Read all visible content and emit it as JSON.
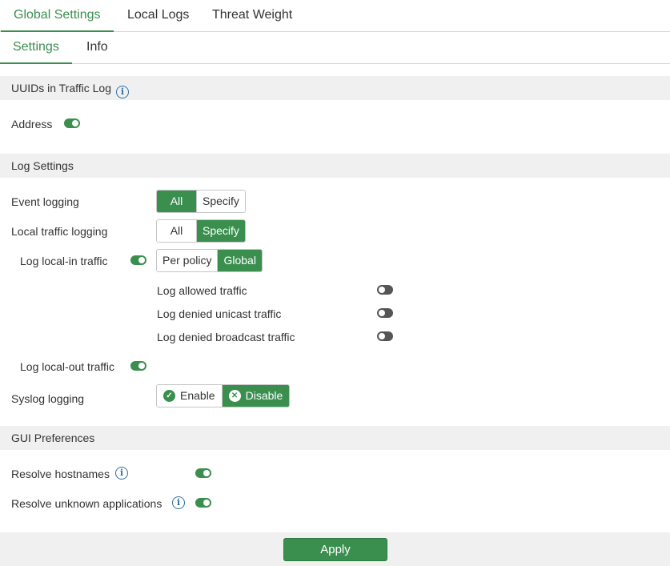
{
  "tabs": [
    "Global Settings",
    "Local Logs",
    "Threat Weight"
  ],
  "subtabs": [
    "Settings",
    "Info"
  ],
  "uuids_section": {
    "title": "UUIDs in Traffic Log",
    "address_label": "Address",
    "address_enabled": true
  },
  "log_settings": {
    "title": "Log Settings",
    "event_logging": {
      "label": "Event logging",
      "options": [
        "All",
        "Specify"
      ],
      "selected": "All"
    },
    "local_traffic_logging": {
      "label": "Local traffic logging",
      "options": [
        "All",
        "Specify"
      ],
      "selected": "Specify"
    },
    "log_local_in": {
      "label": "Log local-in traffic",
      "enabled": true,
      "options": [
        "Per policy",
        "Global"
      ],
      "selected": "Global",
      "sub_options": [
        {
          "label": "Log allowed traffic",
          "enabled": false
        },
        {
          "label": "Log denied unicast traffic",
          "enabled": false
        },
        {
          "label": "Log denied broadcast traffic",
          "enabled": false
        }
      ]
    },
    "log_local_out": {
      "label": "Log local-out traffic",
      "enabled": true
    },
    "syslog_logging": {
      "label": "Syslog logging",
      "options": [
        "Enable",
        "Disable"
      ],
      "selected": "Disable"
    }
  },
  "gui_preferences": {
    "title": "GUI Preferences",
    "resolve_hostnames": {
      "label": "Resolve hostnames",
      "enabled": true
    },
    "resolve_unknown_apps": {
      "label": "Resolve unknown applications",
      "enabled": true
    }
  },
  "apply_label": "Apply",
  "colors": {
    "accent": "#3a8f4f",
    "toggle_off": "#555555",
    "section_bg": "#f0f0f0",
    "info_icon": "#2f6fa3"
  }
}
